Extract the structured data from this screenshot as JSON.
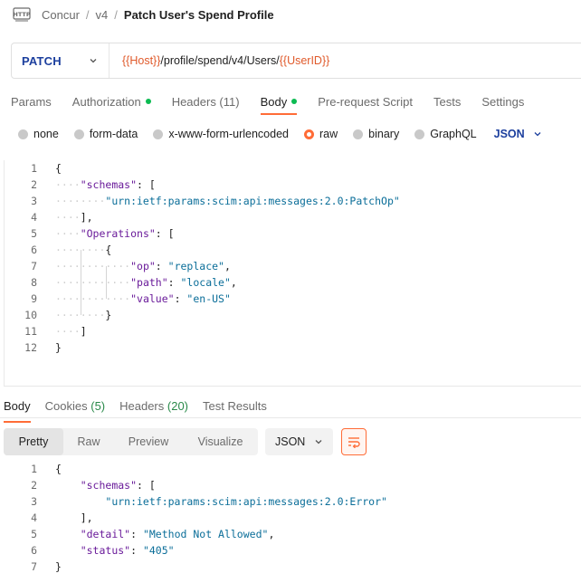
{
  "breadcrumb": {
    "icon": "http-icon",
    "items": [
      "Concur",
      "v4"
    ],
    "current": "Patch User's Spend Profile"
  },
  "request": {
    "method": "PATCH",
    "url_parts": [
      {
        "text": "{{Host}}",
        "var": true
      },
      {
        "text": "/profile/spend/v4/Users/",
        "var": false
      },
      {
        "text": "{{UserID}}",
        "var": true
      }
    ]
  },
  "request_tabs": [
    {
      "label": "Params",
      "dot": false,
      "active": false
    },
    {
      "label": "Authorization",
      "dot": true,
      "active": false
    },
    {
      "label": "Headers (11)",
      "dot": false,
      "active": false
    },
    {
      "label": "Body",
      "dot": true,
      "active": true
    },
    {
      "label": "Pre-request Script",
      "dot": false,
      "active": false
    },
    {
      "label": "Tests",
      "dot": false,
      "active": false
    },
    {
      "label": "Settings",
      "dot": false,
      "active": false
    }
  ],
  "body_types": [
    {
      "label": "none",
      "selected": false
    },
    {
      "label": "form-data",
      "selected": false
    },
    {
      "label": "x-www-form-urlencoded",
      "selected": false
    },
    {
      "label": "raw",
      "selected": true
    },
    {
      "label": "binary",
      "selected": false
    },
    {
      "label": "GraphQL",
      "selected": false
    }
  ],
  "body_language": "JSON",
  "request_body": [
    {
      "n": "1",
      "indent": 0,
      "tokens": [
        {
          "t": "{",
          "c": "punc"
        }
      ]
    },
    {
      "n": "2",
      "indent": 1,
      "tokens": [
        {
          "t": "\"schemas\"",
          "c": "key"
        },
        {
          "t": ": [",
          "c": "punc"
        }
      ]
    },
    {
      "n": "3",
      "indent": 2,
      "tokens": [
        {
          "t": "\"urn:ietf:params:scim:api:messages:2.0:PatchOp\"",
          "c": "str"
        }
      ]
    },
    {
      "n": "4",
      "indent": 1,
      "tokens": [
        {
          "t": "],",
          "c": "punc"
        }
      ]
    },
    {
      "n": "5",
      "indent": 1,
      "tokens": [
        {
          "t": "\"Operations\"",
          "c": "key"
        },
        {
          "t": ": [",
          "c": "punc"
        }
      ]
    },
    {
      "n": "6",
      "indent": 2,
      "tokens": [
        {
          "t": "{",
          "c": "punc"
        }
      ]
    },
    {
      "n": "7",
      "indent": 3,
      "tokens": [
        {
          "t": "\"op\"",
          "c": "key"
        },
        {
          "t": ": ",
          "c": "punc"
        },
        {
          "t": "\"replace\"",
          "c": "str"
        },
        {
          "t": ",",
          "c": "punc"
        }
      ]
    },
    {
      "n": "8",
      "indent": 3,
      "tokens": [
        {
          "t": "\"path\"",
          "c": "key"
        },
        {
          "t": ": ",
          "c": "punc"
        },
        {
          "t": "\"locale\"",
          "c": "str"
        },
        {
          "t": ",",
          "c": "punc"
        }
      ]
    },
    {
      "n": "9",
      "indent": 3,
      "tokens": [
        {
          "t": "\"value\"",
          "c": "key"
        },
        {
          "t": ": ",
          "c": "punc"
        },
        {
          "t": "\"en-US\"",
          "c": "str"
        }
      ]
    },
    {
      "n": "10",
      "indent": 2,
      "tokens": [
        {
          "t": "}",
          "c": "punc"
        }
      ]
    },
    {
      "n": "11",
      "indent": 1,
      "tokens": [
        {
          "t": "]",
          "c": "punc"
        }
      ]
    },
    {
      "n": "12",
      "indent": 0,
      "tokens": [
        {
          "t": "}",
          "c": "punc"
        }
      ]
    }
  ],
  "response_tabs": [
    {
      "label": "Body",
      "count": "",
      "active": true
    },
    {
      "label": "Cookies",
      "count": "(5)",
      "active": false
    },
    {
      "label": "Headers",
      "count": "(20)",
      "active": false
    },
    {
      "label": "Test Results",
      "count": "",
      "active": false
    }
  ],
  "view_modes": [
    {
      "label": "Pretty",
      "active": true
    },
    {
      "label": "Raw",
      "active": false
    },
    {
      "label": "Preview",
      "active": false
    },
    {
      "label": "Visualize",
      "active": false
    }
  ],
  "response_format": "JSON",
  "response_body": [
    {
      "n": "1",
      "indent": 0,
      "tokens": [
        {
          "t": "{",
          "c": "punc"
        }
      ]
    },
    {
      "n": "2",
      "indent": 1,
      "tokens": [
        {
          "t": "\"schemas\"",
          "c": "key"
        },
        {
          "t": ": [",
          "c": "punc"
        }
      ]
    },
    {
      "n": "3",
      "indent": 2,
      "tokens": [
        {
          "t": "\"urn:ietf:params:scim:api:messages:2.0:Error\"",
          "c": "str"
        }
      ]
    },
    {
      "n": "4",
      "indent": 1,
      "tokens": [
        {
          "t": "],",
          "c": "punc"
        }
      ]
    },
    {
      "n": "5",
      "indent": 1,
      "tokens": [
        {
          "t": "\"detail\"",
          "c": "key"
        },
        {
          "t": ": ",
          "c": "punc"
        },
        {
          "t": "\"Method Not Allowed\"",
          "c": "str"
        },
        {
          "t": ",",
          "c": "punc"
        }
      ]
    },
    {
      "n": "6",
      "indent": 1,
      "tokens": [
        {
          "t": "\"status\"",
          "c": "key"
        },
        {
          "t": ": ",
          "c": "punc"
        },
        {
          "t": "\"405\"",
          "c": "str"
        }
      ]
    },
    {
      "n": "7",
      "indent": 0,
      "tokens": [
        {
          "t": "}",
          "c": "punc"
        }
      ]
    }
  ],
  "colors": {
    "accent": "#ff6c37",
    "method": "#1c3f9e",
    "variable": "#e05a2b",
    "ok_dot": "#0cbb52"
  }
}
